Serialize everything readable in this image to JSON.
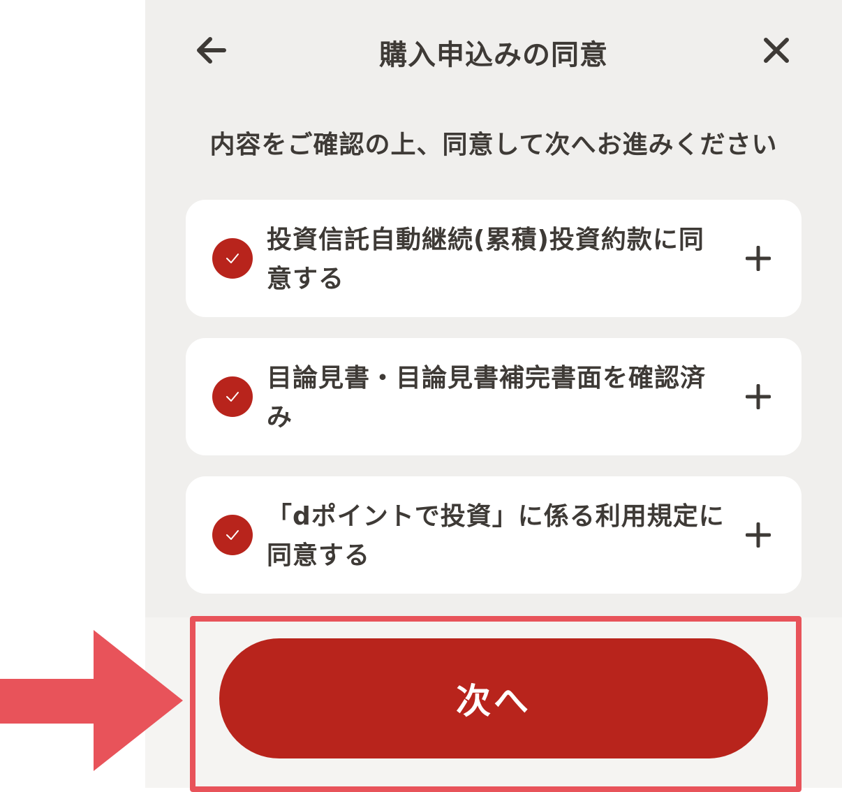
{
  "header": {
    "title": "購入申込みの同意",
    "back_icon": "arrow-left-icon",
    "close_icon": "close-icon"
  },
  "instruction": "内容をご確認の上、同意して次へお進みください",
  "agreements": [
    {
      "label": "投資信託自動継続(累積)投資約款に同意する",
      "checked": true
    },
    {
      "label": "目論見書・目論見書補完書面を確認済み",
      "checked": true
    },
    {
      "label": "「dポイントで投資」に係る利用規定に同意する",
      "checked": true
    }
  ],
  "footer": {
    "next_label": "次へ"
  },
  "colors": {
    "accent": "#b8241c",
    "annotation": "#e8535a",
    "background": "#f0efed",
    "card": "#ffffff",
    "text": "#3e3a36"
  }
}
